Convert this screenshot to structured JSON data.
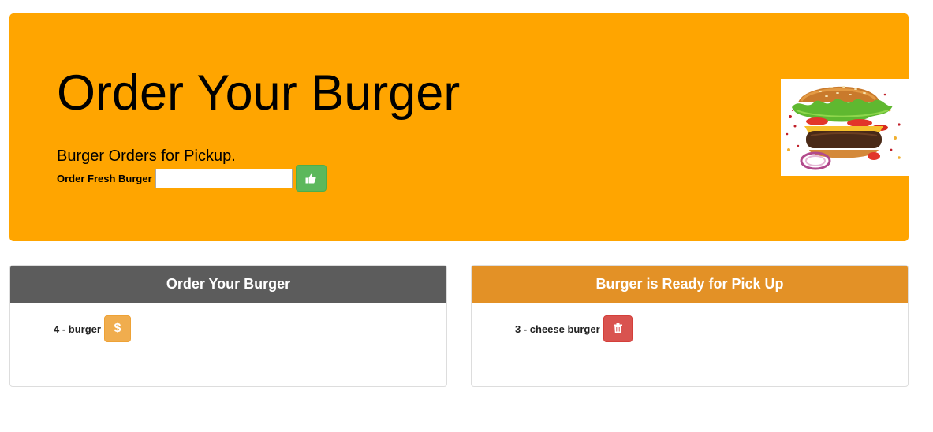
{
  "hero": {
    "title": "Order Your Burger",
    "subtitle": "Burger Orders for Pickup.",
    "form": {
      "label": "Order Fresh Burger",
      "input_value": "",
      "input_placeholder": "",
      "submit_icon": "thumbs-up-icon"
    },
    "image": "burger-image"
  },
  "panels": {
    "order": {
      "heading": "Order Your Burger",
      "items": [
        {
          "text": "4 - burger",
          "button_symbol": "$",
          "button_icon": "dollar-icon"
        }
      ]
    },
    "ready": {
      "heading": "Burger is Ready for Pick Up",
      "items": [
        {
          "text": "3 - cheese burger",
          "button_icon": "trash-icon"
        }
      ]
    }
  },
  "colors": {
    "hero_bg": "#ffa500",
    "order_panel_heading": "#5c5c5c",
    "ready_panel_heading": "#e39126",
    "submit_button": "#5cb85c",
    "devour_button": "#f0ad4e",
    "delete_button": "#d9534f"
  }
}
